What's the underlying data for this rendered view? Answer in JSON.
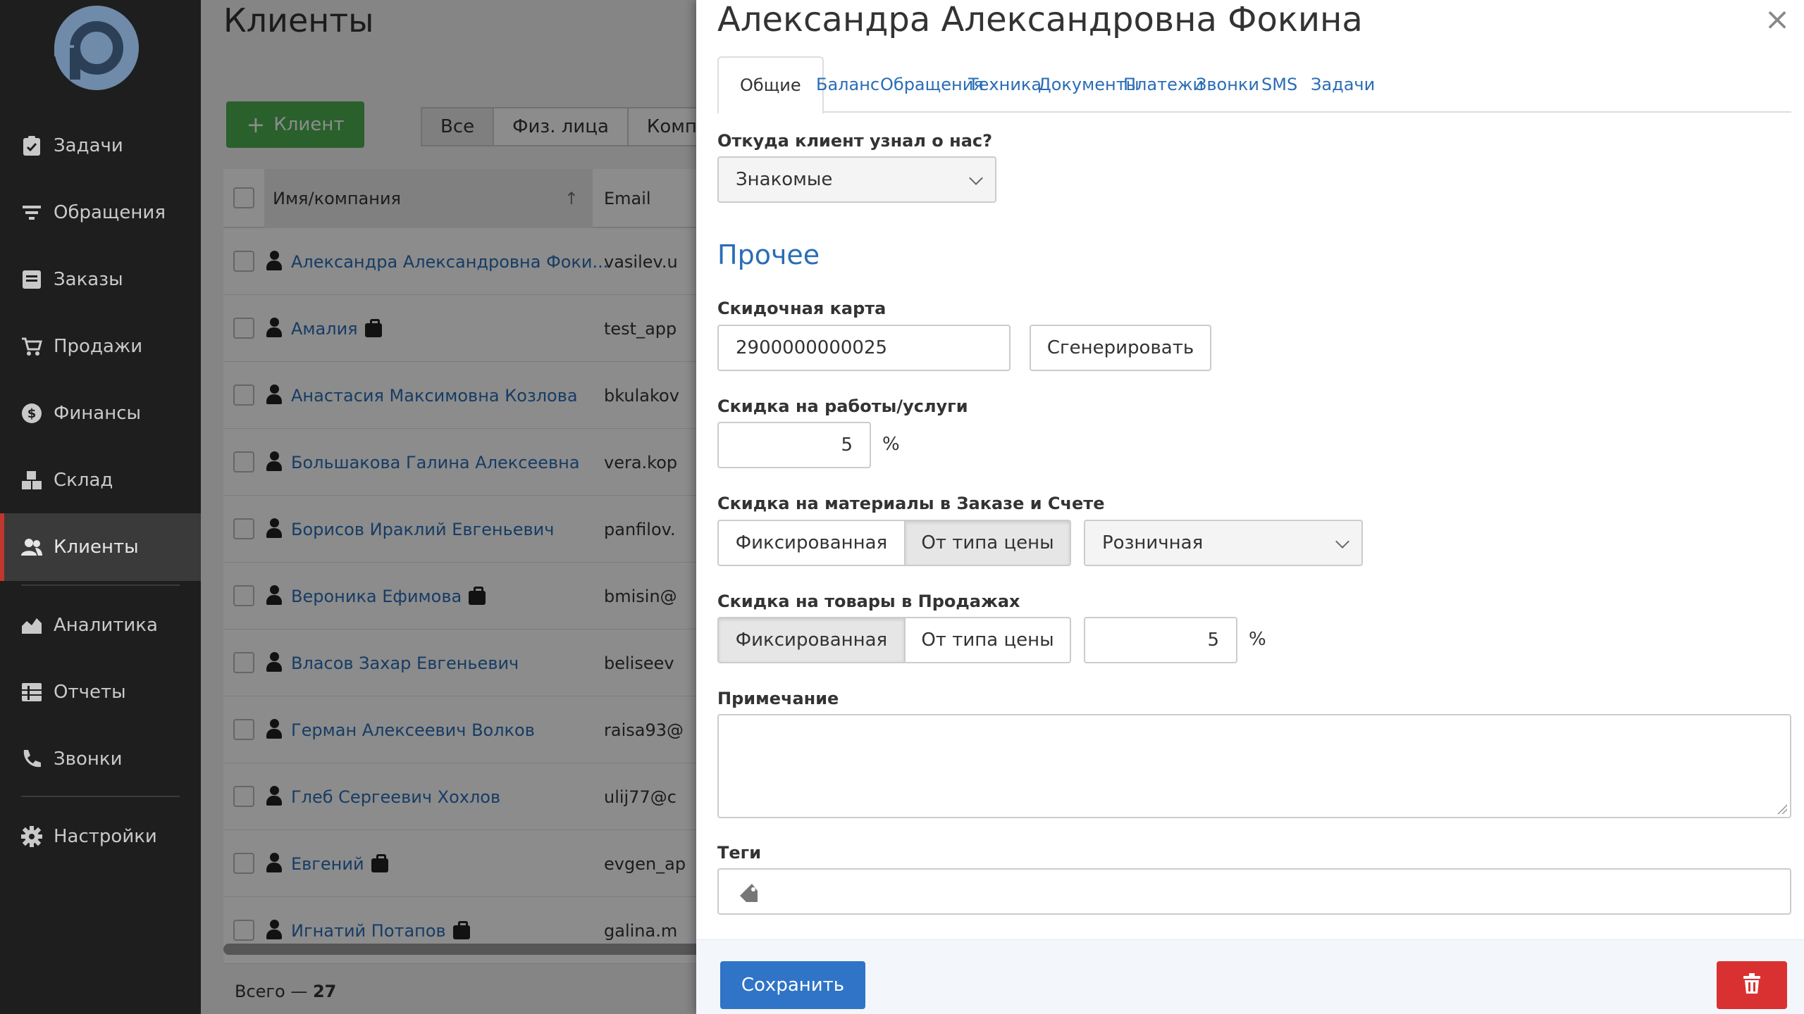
{
  "sidebar": {
    "items": [
      {
        "label": "Задачи",
        "icon": "clipboard-check-icon"
      },
      {
        "label": "Обращения",
        "icon": "filter-icon"
      },
      {
        "label": "Заказы",
        "icon": "list-box-icon"
      },
      {
        "label": "Продажи",
        "icon": "cart-icon"
      },
      {
        "label": "Финансы",
        "icon": "dollar-circle-icon"
      },
      {
        "label": "Склад",
        "icon": "boxes-icon"
      },
      {
        "label": "Клиенты",
        "icon": "users-icon",
        "active": true
      },
      {
        "label": "Аналитика",
        "icon": "area-chart-icon"
      },
      {
        "label": "Отчеты",
        "icon": "table-list-icon"
      },
      {
        "label": "Звонки",
        "icon": "phone-icon"
      },
      {
        "label": "Настройки",
        "icon": "gear-icon"
      }
    ]
  },
  "list": {
    "title": "Клиенты",
    "add_button": "Клиент",
    "filters": [
      "Все",
      "Физ. лица",
      "Компа"
    ],
    "columns": {
      "name": "Имя/компания",
      "email": "Email"
    },
    "rows": [
      {
        "name": "Александра Александровна Фоки...",
        "email": "vasilev.u",
        "company": false
      },
      {
        "name": "Амалия",
        "email": "test_app",
        "company": true
      },
      {
        "name": "Анастасия Максимовна Козлова",
        "email": "bkulakov",
        "company": false
      },
      {
        "name": "Большакова Галина Алексеевна",
        "email": "vera.kop",
        "company": false
      },
      {
        "name": "Борисов Ираклий Евгеньевич",
        "email": "panfilov.",
        "company": false
      },
      {
        "name": "Вероника Ефимова",
        "email": "bmisin@",
        "company": true
      },
      {
        "name": "Власов Захар Евгеньевич",
        "email": "beliseev",
        "company": false
      },
      {
        "name": "Герман Алексеевич Волков",
        "email": "raisa93@",
        "company": false
      },
      {
        "name": "Глеб Сергеевич Хохлов",
        "email": "ulij77@c",
        "company": false
      },
      {
        "name": "Евгений",
        "email": "evgen_ap",
        "company": true
      },
      {
        "name": "Игнатий Потапов",
        "email": "galina.m",
        "company": true
      }
    ],
    "total_label": "Всего — ",
    "total_value": "27"
  },
  "drawer": {
    "title": "Александра Александровна Фокина",
    "tabs": [
      "Общие",
      "Баланс",
      "Обращения",
      "Техника",
      "Документы",
      "Платежи",
      "Звонки",
      "SMS",
      "Задачи"
    ],
    "source": {
      "label": "Откуда клиент узнал о нас?",
      "value": "Знакомые"
    },
    "section_other": "Прочее",
    "discount_card": {
      "label": "Скидочная карта",
      "value": "2900000000025",
      "generate": "Сгенерировать"
    },
    "service_discount": {
      "label": "Скидка на работы/услуги",
      "value": "5",
      "unit": "%"
    },
    "material_discount": {
      "label": "Скидка на материалы в Заказе и Счете",
      "options": [
        "Фиксированная",
        "От типа цены"
      ],
      "selected": "От типа цены",
      "price_type": "Розничная"
    },
    "goods_discount": {
      "label": "Скидка на товары в Продажах",
      "options": [
        "Фиксированная",
        "От типа цены"
      ],
      "selected": "Фиксированная",
      "value": "5",
      "unit": "%"
    },
    "note": {
      "label": "Примечание",
      "value": ""
    },
    "tags": {
      "label": "Теги"
    },
    "save_button": "Сохранить"
  },
  "colors": {
    "sidebar_bg": "#1e1e1e",
    "active_marker": "#c0372f",
    "link": "#2a6db6",
    "add_green": "#4caf50",
    "save_blue": "#2f74c7",
    "delete_red": "#d93131"
  }
}
